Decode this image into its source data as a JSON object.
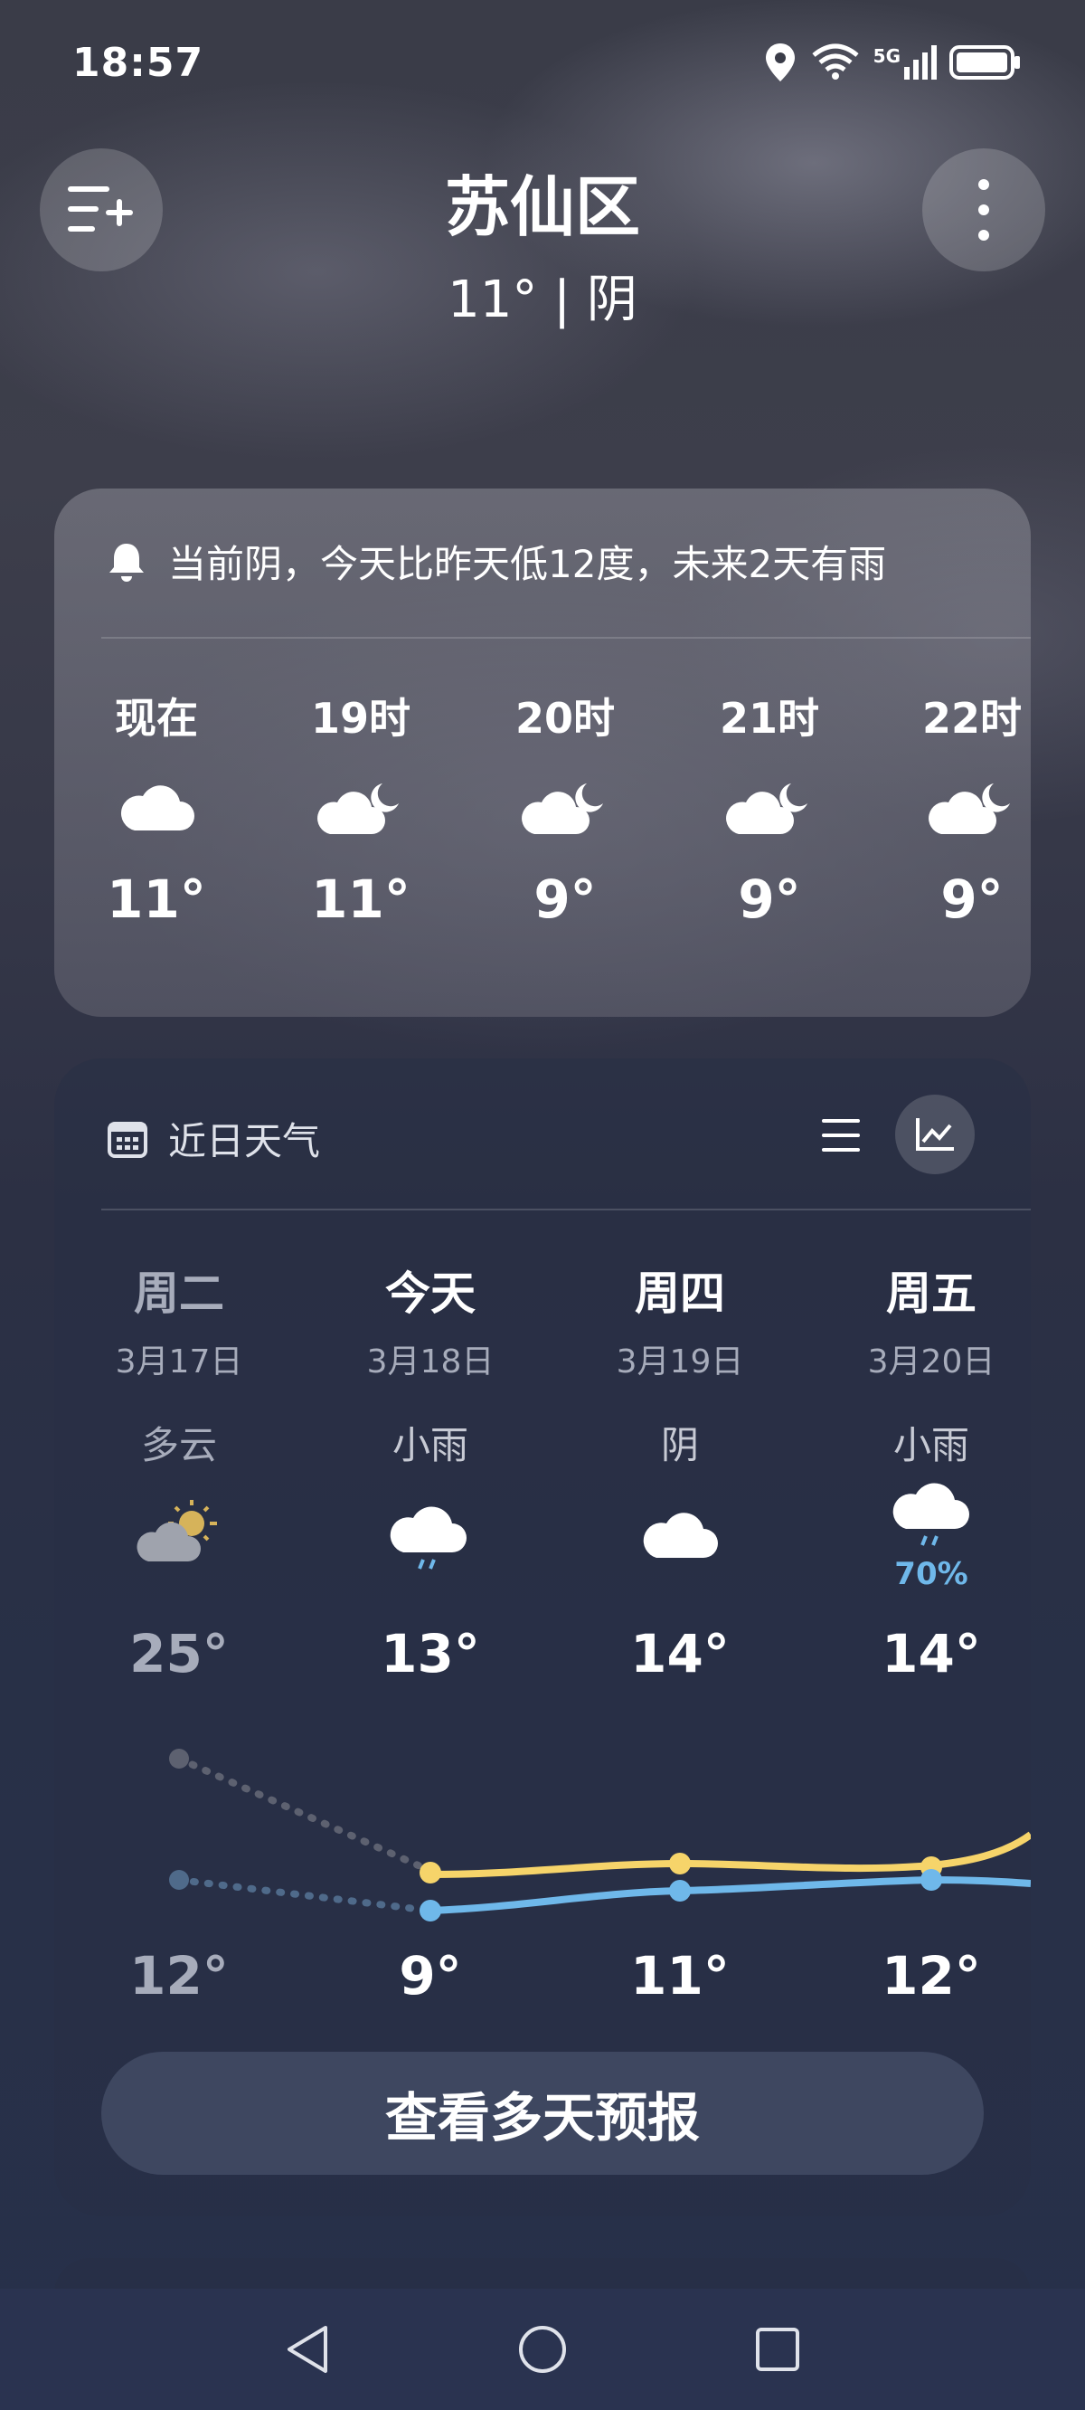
{
  "status": {
    "time": "18:57",
    "network": "5G"
  },
  "header": {
    "city": "苏仙区",
    "current": "11° | 阴"
  },
  "alert": {
    "text": "当前阴，今天比昨天低12度，未来2天有雨"
  },
  "hourly": [
    {
      "label": "现在",
      "icon": "cloud-icon",
      "temp": "11°"
    },
    {
      "label": "19时",
      "icon": "cloud-moon-icon",
      "temp": "11°"
    },
    {
      "label": "20时",
      "icon": "cloud-moon-icon",
      "temp": "9°"
    },
    {
      "label": "21时",
      "icon": "cloud-moon-icon",
      "temp": "9°"
    },
    {
      "label": "22时",
      "icon": "cloud-moon-icon",
      "temp": "9°"
    }
  ],
  "daily_section": {
    "title": "近日天气",
    "list_view": "list-icon",
    "chart_view": "trend-chart-icon"
  },
  "daily": [
    {
      "day": "周二",
      "date": "3月17日",
      "cond": "多云",
      "icon": "partly-sunny-icon",
      "high": "25°",
      "low": "12°",
      "precip": ""
    },
    {
      "day": "今天",
      "date": "3月18日",
      "cond": "小雨",
      "icon": "light-rain-icon",
      "high": "13°",
      "low": "9°",
      "precip": ""
    },
    {
      "day": "周四",
      "date": "3月19日",
      "cond": "阴",
      "icon": "cloud-icon",
      "high": "14°",
      "low": "11°",
      "precip": ""
    },
    {
      "day": "周五",
      "date": "3月20日",
      "cond": "小雨",
      "icon": "light-rain-icon",
      "high": "14°",
      "low": "12°",
      "precip": "70%"
    }
  ],
  "forecast_button": "查看多天预报",
  "colors": {
    "high_line": "#f6d46a",
    "low_line": "#6fb8ea",
    "past_dot": "#5d6170",
    "precip": "#6fb8ea"
  }
}
